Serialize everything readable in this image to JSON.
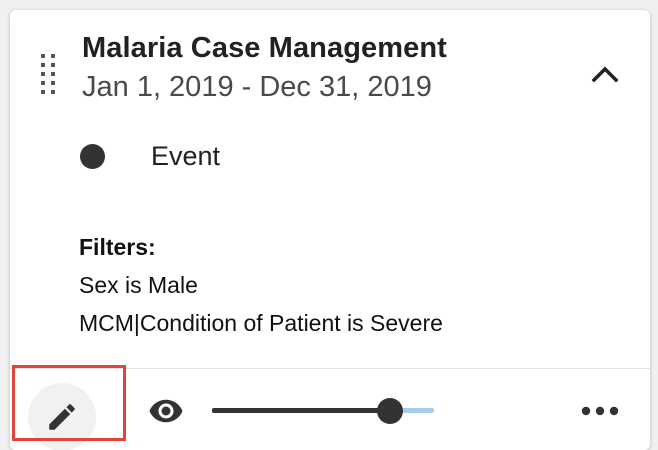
{
  "layer": {
    "title": "Malaria Case Management",
    "period": "Jan 1, 2019 - Dec 31, 2019"
  },
  "legend": {
    "label": "Event",
    "dot_color": "#333333"
  },
  "filters": {
    "heading": "Filters:",
    "items": [
      "Sex is Male",
      "MCM|Condition of Patient is Severe"
    ]
  },
  "toolbar": {
    "edit_icon": "pencil-icon",
    "visibility_icon": "eye-icon",
    "opacity": 0.8,
    "more_icon": "more-horizontal-icon",
    "collapse_icon": "chevron-up-icon"
  },
  "colors": {
    "text": "#212121",
    "icon": "#333333",
    "slider_track": "#a9cbee",
    "highlight": "#e0443a"
  }
}
